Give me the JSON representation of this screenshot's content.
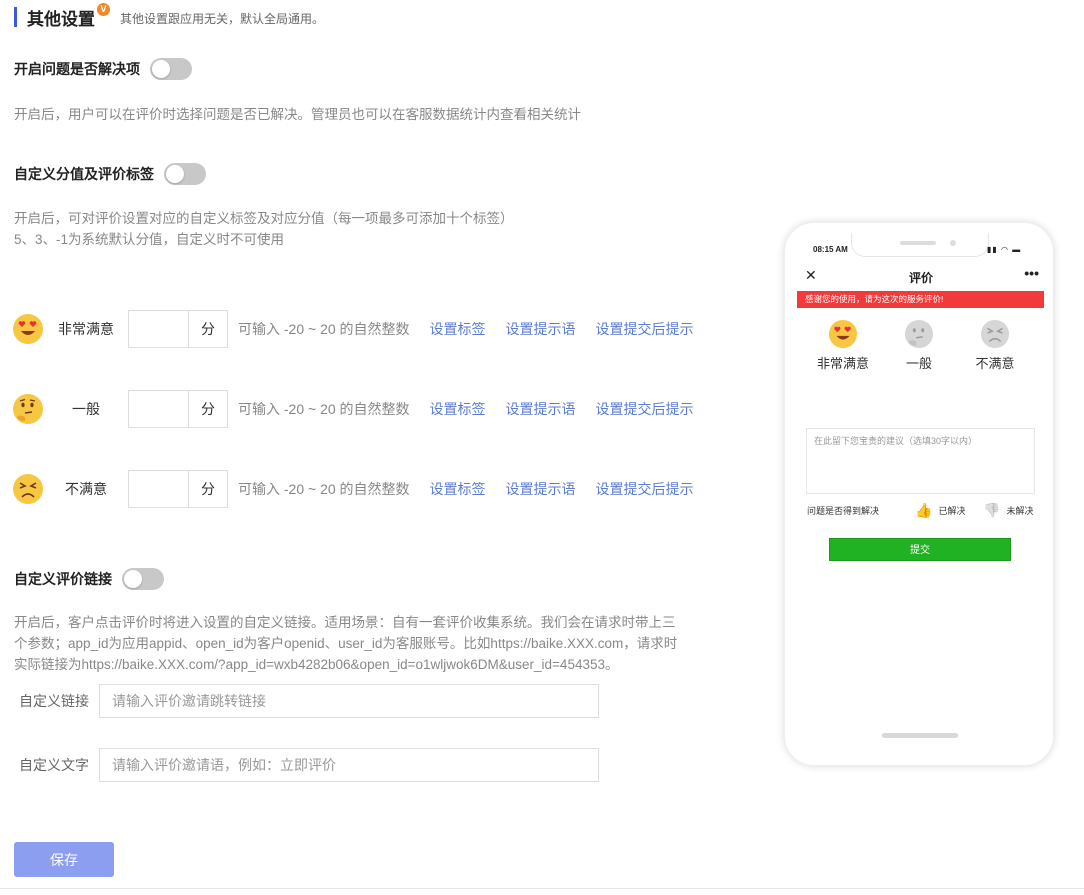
{
  "header": {
    "title": "其他设置",
    "badge": "V",
    "subtitle": "其他设置跟应用无关，默认全局通用。"
  },
  "resolve_toggle": {
    "label": "开启问题是否解决项",
    "enabled": false,
    "desc": "开启后，用户可以在评价时选择问题是否已解决。管理员也可以在客服数据统计内查看相关统计"
  },
  "custom_score_toggle": {
    "label": "自定义分值及评价标签",
    "enabled": false,
    "desc_line1": "开启后，可对评价设置对应的自定义标签及对应分值（每一项最多可添加十个标签）",
    "desc_line2": "5、3、-1为系统默认分值，自定义时不可使用"
  },
  "score_rows": [
    {
      "icon": "heart-eyes-emoji-icon",
      "name": "非常满意",
      "value": "",
      "unit": "分",
      "hint": "可输入 -20 ~ 20 的自然整数",
      "link_tag": "设置标签",
      "link_tip": "设置提示语",
      "link_after": "设置提交后提示"
    },
    {
      "icon": "thinking-emoji-icon",
      "name": "一般",
      "value": "",
      "unit": "分",
      "hint": "可输入 -20 ~ 20 的自然整数",
      "link_tag": "设置标签",
      "link_tip": "设置提示语",
      "link_after": "设置提交后提示"
    },
    {
      "icon": "frustrated-emoji-icon",
      "name": "不满意",
      "value": "",
      "unit": "分",
      "hint": "可输入 -20 ~ 20 的自然整数",
      "link_tag": "设置标签",
      "link_tip": "设置提示语",
      "link_after": "设置提交后提示"
    }
  ],
  "custom_link_toggle": {
    "label": "自定义评价链接",
    "enabled": false,
    "desc_line1": "开启后，客户点击评价时将进入设置的自定义链接。适用场景：自有一套评价收集系统。我们会在请求时带上三",
    "desc_line2": "个参数；app_id为应用appid、open_id为客户openid、user_id为客服账号。比如https://baike.XXX.com，请求时",
    "desc_line3": "实际链接为https://baike.XXX.com/?app_id=wxb4282b06&open_id=o1wljwok6DM&user_id=454353。"
  },
  "form": {
    "link_label": "自定义链接",
    "link_value": "",
    "link_placeholder": "请输入评价邀请跳转链接",
    "text_label": "自定义文字",
    "text_value": "",
    "text_placeholder": "请输入评价邀请语，例如：立即评价"
  },
  "save_label": "保存",
  "phone_preview": {
    "time": "08:15 AM",
    "close": "✕",
    "title": "评价",
    "more": "•••",
    "banner": "感谢您的使用，请为这次的服务评价!",
    "faces": [
      {
        "label": "非常满意"
      },
      {
        "label": "一般"
      },
      {
        "label": "不满意"
      }
    ],
    "textarea_placeholder": "在此留下您宝贵的建议（选填30字以内）",
    "resolve_question": "问题是否得到解决",
    "resolved": "已解决",
    "unresolved": "未解决",
    "submit": "提交"
  }
}
